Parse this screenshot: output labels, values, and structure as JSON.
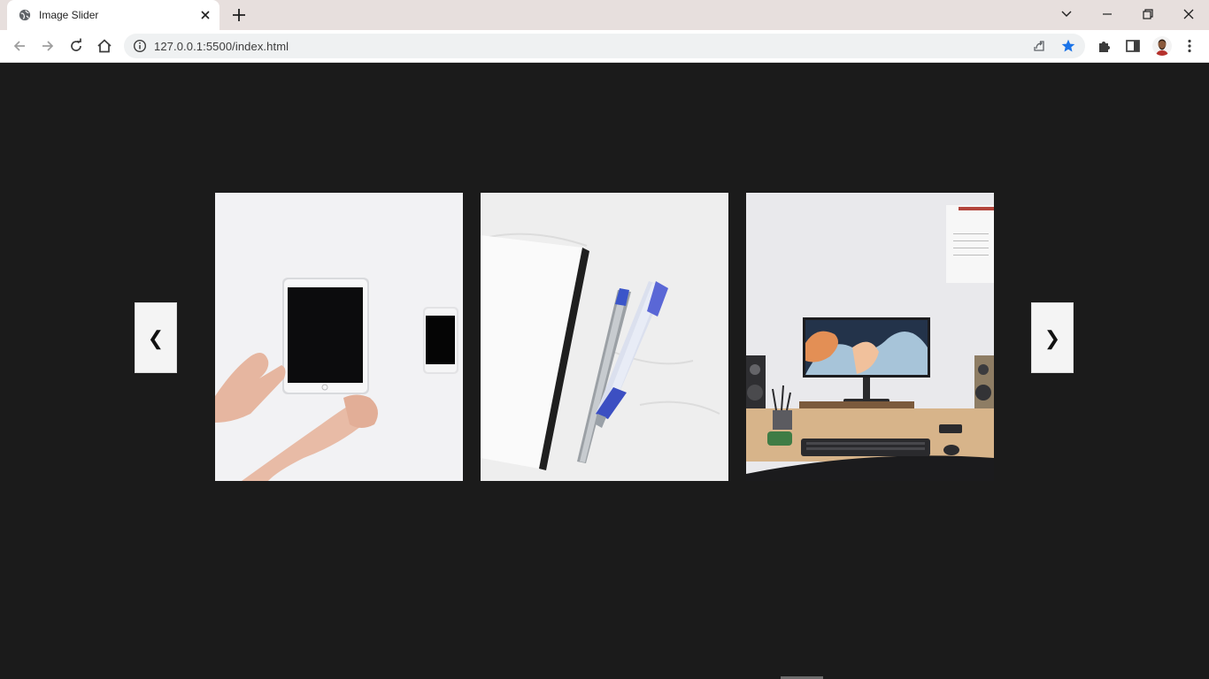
{
  "browser": {
    "tab": {
      "title": "Image Slider",
      "favicon_icon": "globe-icon",
      "close_icon": "close-icon"
    },
    "new_tab_icon": "plus-icon",
    "window_controls": [
      "chevron-down-icon",
      "minimize-icon",
      "restore-icon",
      "close-icon"
    ],
    "nav_icons": [
      "back-arrow-icon",
      "forward-arrow-icon",
      "reload-icon",
      "home-icon"
    ],
    "url": "127.0.0.1:5500/index.html",
    "omnibox_icons": [
      "info-icon",
      "share-icon",
      "star-icon"
    ],
    "toolbar_icons": [
      "extensions-icon",
      "side-panel-icon",
      "avatar",
      "menu-kebab-icon"
    ],
    "colors": {
      "tabstrip": "#e7dfdd",
      "star_accent": "#1a73e8"
    }
  },
  "page": {
    "background": "#1b1b1b",
    "prev_label": "❮",
    "next_label": "❯",
    "slides": [
      {
        "name": "slide-tablet-phone"
      },
      {
        "name": "slide-notebook-pens"
      },
      {
        "name": "slide-desk-monitor"
      }
    ]
  }
}
